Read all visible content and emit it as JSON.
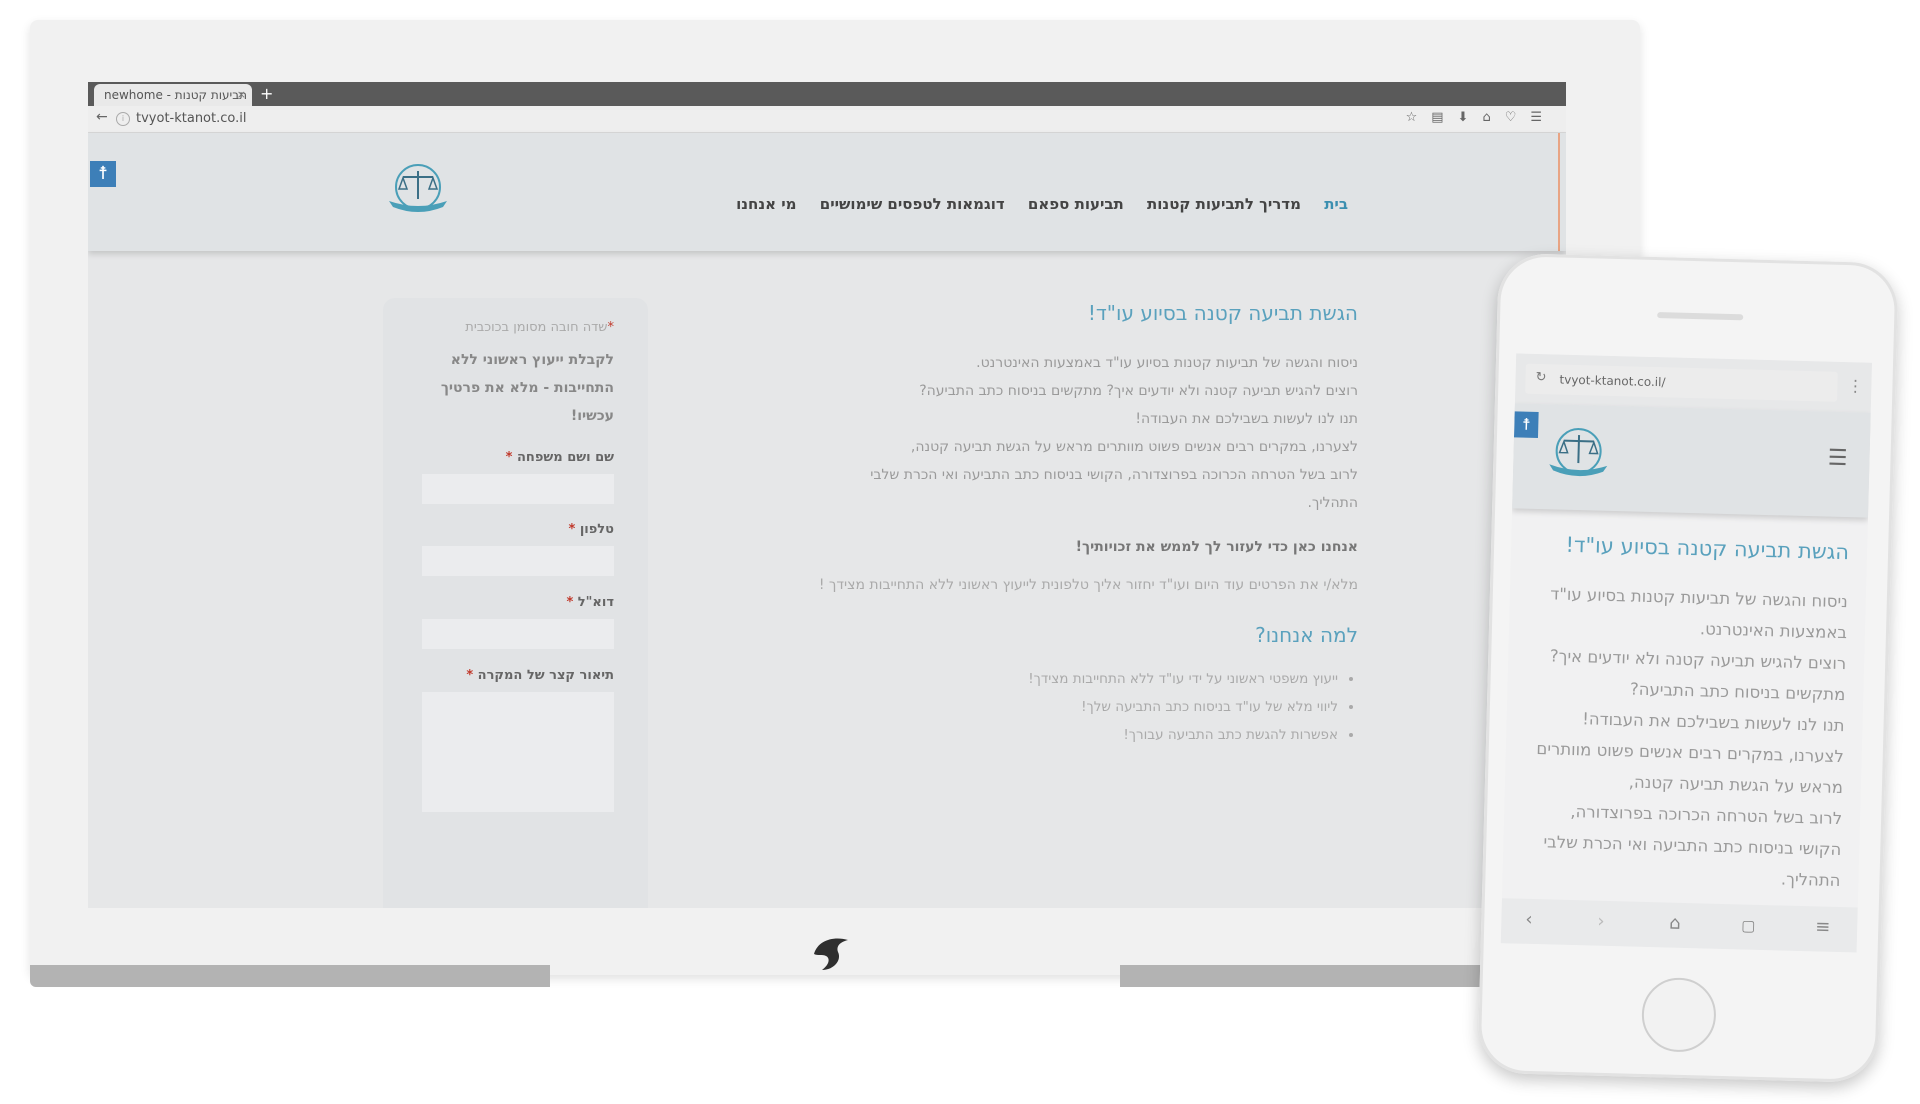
{
  "desktop": {
    "browser": {
      "tab_title": "newhome - תביעות קטנות",
      "tab_close": "×",
      "new_tab": "+",
      "url": "tvyot-ktanot.co.il"
    },
    "nav": {
      "items": [
        "בית",
        "מדריך לתביעות קטנות",
        "תביעות ספאם",
        "דוגמאות לטפסים שימושיים",
        "מי אנחנו"
      ]
    },
    "content": {
      "heading": "הגשת תביעה קטנה בסיוע עו\"ד!",
      "paragraph_lines": [
        "ניסוח והגשה של תביעות קטנות בסיוע עו\"ד באמצעות האינטרנט.",
        "רוצים להגיש תביעה קטנה ולא יודעים איך? מתקשים בניסוח כתב התביעה?",
        "תנו לנו לעשות בשבילכם את העבודה!",
        "לצערנו, במקרים רבים אנשים פשוט מוותרים מראש על הגשת תביעה קטנה,",
        "לרוב בשל הטרחה הכרוכה בפרוצדורה, הקושי בניסוח כתב התביעה ואי הכרת שלבי",
        "התהליך."
      ],
      "bold_line": "אנחנו כאן כדי לעזור לך לממש את זכויותיך!",
      "fill_line": "מלא/י את הפרטים עוד היום ועו\"ד יחזור אליך טלפונית לייעוץ ראשוני ללא התחייבות מצידך !",
      "why_heading": "למה אנחנו?",
      "bullets": [
        "ייעוץ משפטי ראשוני על ידי עו\"ד ללא התחייבות מצידך!",
        "ליווי מלא של עו\"ד בניסוח כתב התביעה שלך!",
        "אפשרות להגשת כתב התביעה עבורך!"
      ]
    },
    "form": {
      "required_star": "*",
      "required_note": "שדה חובה מסומן בכוכבית",
      "intro": "לקבלת ייעוץ ראשוני ללא התחייבות - מלא את פרטיך עכשיו!",
      "fields": [
        {
          "label": "שם ושם משפחה",
          "star": "*"
        },
        {
          "label": "טלפון",
          "star": "*"
        },
        {
          "label": "דוא\"ל",
          "star": "*"
        },
        {
          "label": "תיאור קצר של המקרה",
          "star": "*"
        }
      ]
    }
  },
  "mobile": {
    "url": "tvyot-ktanot.co.il/",
    "heading": "הגשת תביעה קטנה בסיוע עו\"ד!",
    "paragraph_lines": [
      "ניסוח והגשה של תביעות קטנות בסיוע עו\"ד",
      "באמצעות האינטרנט.",
      "רוצים להגיש תביעה קטנה ולא יודעים איך?",
      "מתקשים בניסוח כתב התביעה?",
      "תנו לנו לעשות בשבילכם את העבודה!",
      "לצערנו, במקרים רבים אנשים פשוט מוותרים",
      "מראש על הגשת תביעה קטנה,",
      "לרוב בשל הטרחה הכרוכה בפרוצדורה,",
      "הקושי בניסוח כתב התביעה ואי הכרת שלבי",
      "התהליך."
    ]
  },
  "colors": {
    "accent": "#5aa1bd",
    "accessibility": "#3d7fb8",
    "required": "#c0392b"
  },
  "icons": [
    "accessibility-icon",
    "scales-of-justice-logo",
    "hamburger-menu-icon",
    "back-arrow-icon",
    "home-icon",
    "tabs-icon"
  ]
}
